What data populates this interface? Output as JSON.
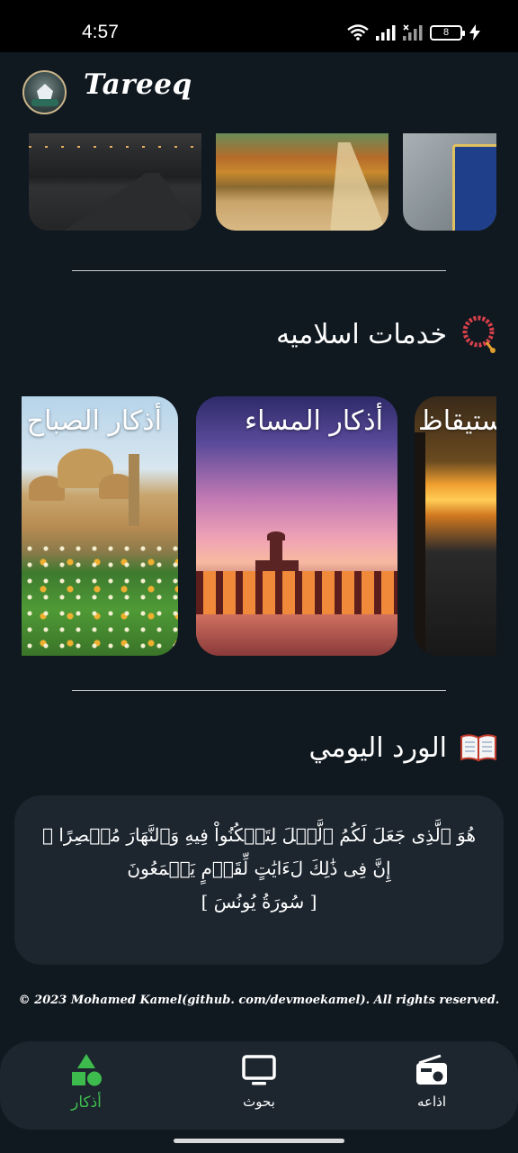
{
  "status_bar": {
    "time": "4:57",
    "battery": "8"
  },
  "header": {
    "title": "Tareeq"
  },
  "top_carousel": {
    "images": [
      "road-at-dusk",
      "autumn-field-path",
      "prayer-rug"
    ]
  },
  "services": {
    "title": "خدمات اسلاميه",
    "cards": [
      {
        "label": "أذكار الصباح"
      },
      {
        "label": "أذكار المساء"
      },
      {
        "label": "ستيقاظ"
      }
    ]
  },
  "daily_wird": {
    "title": "الورد اليومي",
    "verse": "هُوَ ٱلَّذِى جَعَلَ لَكُمُ ٱلَّيۡلَ لِتَسۡكُنُواْ فِيهِ وَٱلنَّهَارَ مُبۡصِرًا ۚ إِنَّ فِى ذَٰلِكَ لَءَايَٰتٍ لِّقَوۡمٍ يَسۡمَعُونَ",
    "reference": "[ سُورَةُ يُونُسَ ]"
  },
  "footer": {
    "copyright": "© 2023 Mohamed Kamel(github. com/devmoekamel).  All rights reserved."
  },
  "bottom_nav": {
    "items": [
      {
        "label": "أذكار",
        "icon": "shapes-icon",
        "active": true
      },
      {
        "label": "بحوث",
        "icon": "monitor-icon",
        "active": false
      },
      {
        "label": "اذاعه",
        "icon": "radio-icon",
        "active": false
      }
    ],
    "active_color": "#3dbc4d"
  },
  "colors": {
    "background": "#101820",
    "surface": "#1d262f",
    "accent": "#3dbc4d"
  }
}
